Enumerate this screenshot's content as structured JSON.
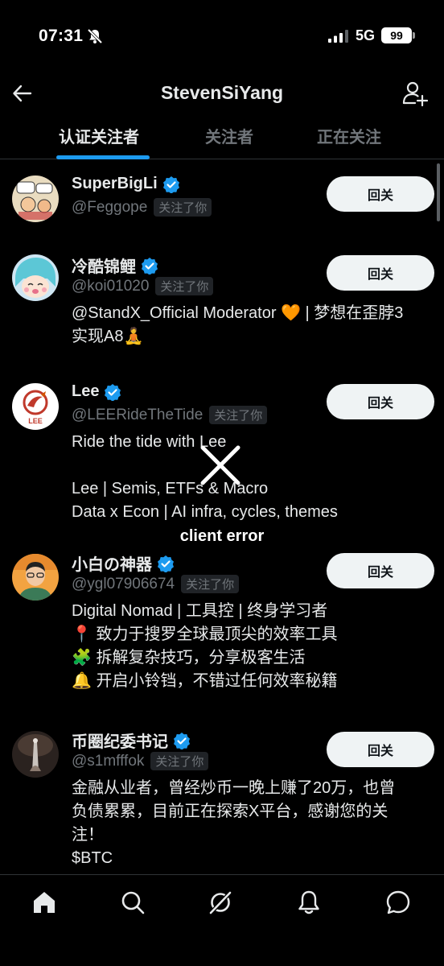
{
  "status_bar": {
    "time": "07:31",
    "network": "5G",
    "battery": "99"
  },
  "header": {
    "title": "StevenSiYang"
  },
  "tabs": [
    {
      "label": "认证关注者",
      "active": true
    },
    {
      "label": "关注者",
      "active": false
    },
    {
      "label": "正在关注",
      "active": false
    }
  ],
  "users": [
    {
      "name": "SuperBigLi",
      "handle": "@Feggope",
      "follows_you": "关注了你",
      "bio": "",
      "button": "回关"
    },
    {
      "name": "冷酷锦鲤",
      "handle": "@koi01020",
      "follows_you": "关注了你",
      "bio": "@StandX_Official Moderator 🧡 | 梦想在歪脖3\n实现A8🧘",
      "button": "回关"
    },
    {
      "name": "Lee",
      "handle": "@LEERideTheTide",
      "follows_you": "关注了你",
      "bio": "Ride the tide with Lee\n\nLee | Semis, ETFs & Macro\nData x Econ | AI infra, cycles, themes",
      "button": "回关"
    },
    {
      "name": "小白の神器",
      "handle": "@ygl07906674",
      "follows_you": "关注了你",
      "bio": "Digital Nomad | 工具控 | 终身学习者\n📍 致力于搜罗全球最顶尖的效率工具\n🧩 拆解复杂技巧，分享极客生活\n🔔 开启小铃铛，不错过任何效率秘籍",
      "button": "回关"
    },
    {
      "name": "币圈纪委书记",
      "handle": "@s1mfffok",
      "follows_you": "关注了你",
      "bio": "金融从业者，曾经炒币一晚上赚了20万，也曾\n负债累累，目前正在探索X平台，感谢您的关\n注！\n$BTC",
      "button": "回关"
    }
  ],
  "error": {
    "text": "client error"
  },
  "colors": {
    "accent": "#1d9bf0",
    "background": "#000000",
    "muted": "#71767b"
  },
  "icons": {
    "nav": [
      "home-icon",
      "search-icon",
      "grok-icon",
      "notifications-icon",
      "messages-icon"
    ]
  }
}
